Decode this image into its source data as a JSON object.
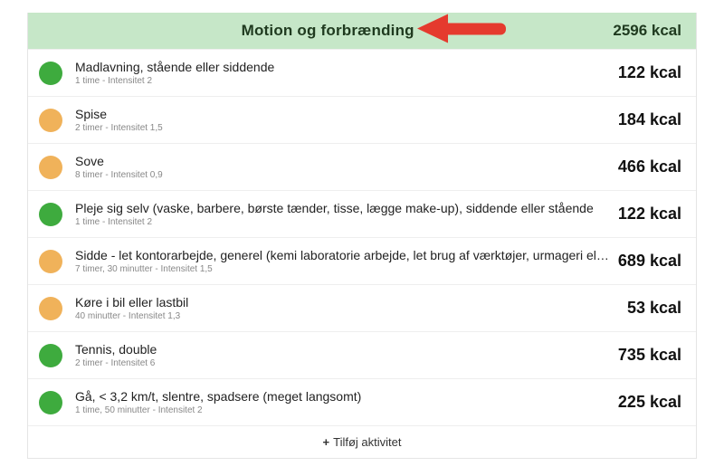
{
  "header": {
    "title": "Motion og forbrænding",
    "total": "2596 kcal"
  },
  "unit_suffix": "kcal",
  "activities": [
    {
      "color": "green",
      "title": "Madlavning, stående eller siddende",
      "sub": "1 time - Intensitet 2",
      "kcal": "122 kcal"
    },
    {
      "color": "orange",
      "title": "Spise",
      "sub": "2 timer - Intensitet 1,5",
      "kcal": "184 kcal"
    },
    {
      "color": "orange",
      "title": "Sove",
      "sub": "8 timer - Intensitet 0,9",
      "kcal": "466 kcal"
    },
    {
      "color": "green",
      "title": "Pleje sig selv (vaske, barbere, børste tænder, tisse, lægge make-up), siddende eller stående",
      "sub": "1 time - Intensitet 2",
      "kcal": "122 kcal"
    },
    {
      "color": "orange",
      "title": "Sidde - let kontorarbejde, generel (kemi laboratorie arbejde, let brug af værktøjer, urmageri eller le...",
      "sub": "7 timer, 30 minutter - Intensitet 1,5",
      "kcal": "689 kcal"
    },
    {
      "color": "orange",
      "title": "Køre i bil eller lastbil",
      "sub": "40 minutter - Intensitet 1,3",
      "kcal": "53 kcal"
    },
    {
      "color": "green",
      "title": "Tennis, double",
      "sub": "2 timer - Intensitet 6",
      "kcal": "735 kcal"
    },
    {
      "color": "green",
      "title": "Gå, < 3,2 km/t, slentre, spadsere (meget langsomt)",
      "sub": "1 time, 50 minutter - Intensitet 2",
      "kcal": "225 kcal"
    }
  ],
  "add_label": "Tilføj aktivitet",
  "annotation": {
    "arrow_color": "#e53a2e"
  }
}
